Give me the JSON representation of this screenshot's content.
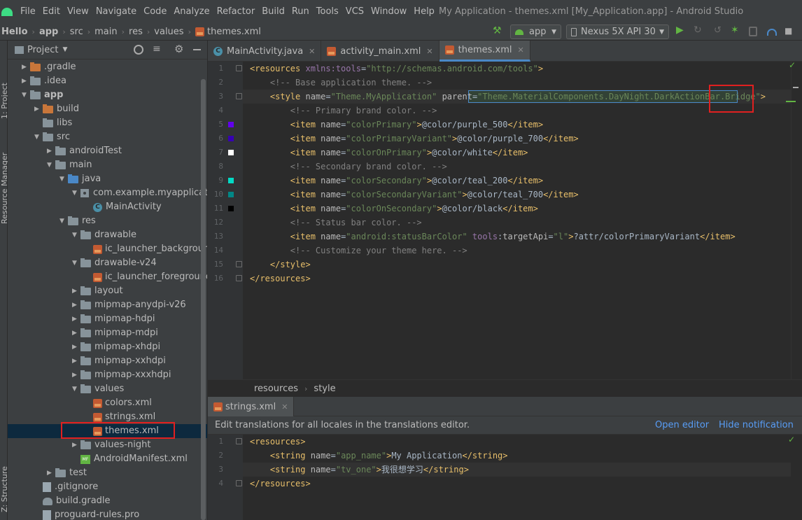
{
  "menu": {
    "items": [
      "File",
      "Edit",
      "View",
      "Navigate",
      "Code",
      "Analyze",
      "Refactor",
      "Build",
      "Run",
      "Tools",
      "VCS",
      "Window",
      "Help"
    ],
    "window_title": "My Application - themes.xml [My_Application.app] - Android Studio"
  },
  "nav": {
    "crumbs": [
      "Hello",
      "app",
      "src",
      "main",
      "res",
      "values",
      "themes.xml"
    ],
    "run_config": "app",
    "device": "Nexus 5X API 30"
  },
  "side": {
    "project_label": "1: Project",
    "resource_manager_label": "Resource Manager",
    "structure_label": "Z: Structure"
  },
  "project": {
    "view_mode": "Project",
    "tree": [
      {
        "label": ".gradle",
        "kind": "folder-orange",
        "arrow": "▶",
        "indent": 0
      },
      {
        "label": ".idea",
        "kind": "folder",
        "arrow": "▶",
        "indent": 0
      },
      {
        "label": "app",
        "kind": "folder",
        "arrow": "▼",
        "indent": 0,
        "bold": true
      },
      {
        "label": "build",
        "kind": "folder-orange",
        "arrow": "▶",
        "indent": 1
      },
      {
        "label": "libs",
        "kind": "folder",
        "arrow": "",
        "indent": 1
      },
      {
        "label": "src",
        "kind": "folder",
        "arrow": "▼",
        "indent": 1
      },
      {
        "label": "androidTest",
        "kind": "folder",
        "arrow": "▶",
        "indent": 2
      },
      {
        "label": "main",
        "kind": "folder",
        "arrow": "▼",
        "indent": 2
      },
      {
        "label": "java",
        "kind": "folder-blue",
        "arrow": "▼",
        "indent": 3
      },
      {
        "label": "com.example.myapplication",
        "kind": "package",
        "arrow": "▼",
        "indent": 4
      },
      {
        "label": "MainActivity",
        "kind": "class",
        "arrow": "",
        "indent": 5
      },
      {
        "label": "res",
        "kind": "folder",
        "arrow": "▼",
        "indent": 3
      },
      {
        "label": "drawable",
        "kind": "folder",
        "arrow": "▼",
        "indent": 4
      },
      {
        "label": "ic_launcher_background.xml",
        "kind": "xml",
        "arrow": "",
        "indent": 5
      },
      {
        "label": "drawable-v24",
        "kind": "folder",
        "arrow": "▼",
        "indent": 4
      },
      {
        "label": "ic_launcher_foreground.xml",
        "kind": "xml",
        "arrow": "",
        "indent": 5
      },
      {
        "label": "layout",
        "kind": "folder",
        "arrow": "▶",
        "indent": 4
      },
      {
        "label": "mipmap-anydpi-v26",
        "kind": "folder",
        "arrow": "▶",
        "indent": 4
      },
      {
        "label": "mipmap-hdpi",
        "kind": "folder",
        "arrow": "▶",
        "indent": 4
      },
      {
        "label": "mipmap-mdpi",
        "kind": "folder",
        "arrow": "▶",
        "indent": 4
      },
      {
        "label": "mipmap-xhdpi",
        "kind": "folder",
        "arrow": "▶",
        "indent": 4
      },
      {
        "label": "mipmap-xxhdpi",
        "kind": "folder",
        "arrow": "▶",
        "indent": 4
      },
      {
        "label": "mipmap-xxxhdpi",
        "kind": "folder",
        "arrow": "▶",
        "indent": 4
      },
      {
        "label": "values",
        "kind": "folder",
        "arrow": "▼",
        "indent": 4
      },
      {
        "label": "colors.xml",
        "kind": "xml",
        "arrow": "",
        "indent": 5
      },
      {
        "label": "strings.xml",
        "kind": "xml",
        "arrow": "",
        "indent": 5
      },
      {
        "label": "themes.xml",
        "kind": "xml",
        "arrow": "",
        "indent": 5,
        "selected": true
      },
      {
        "label": "values-night",
        "kind": "folder",
        "arrow": "▶",
        "indent": 4
      },
      {
        "label": "AndroidManifest.xml",
        "kind": "manifest",
        "arrow": "",
        "indent": 4
      },
      {
        "label": "test",
        "kind": "folder",
        "arrow": "▶",
        "indent": 2
      },
      {
        "label": ".gitignore",
        "kind": "file",
        "arrow": "",
        "indent": 1
      },
      {
        "label": "build.gradle",
        "kind": "gradle",
        "arrow": "",
        "indent": 1
      },
      {
        "label": "proguard-rules.pro",
        "kind": "file",
        "arrow": "",
        "indent": 1
      }
    ]
  },
  "editor": {
    "tabs": [
      {
        "label": "MainActivity.java",
        "icon": "java-class-icon"
      },
      {
        "label": "activity_main.xml",
        "icon": "xml-file-icon"
      },
      {
        "label": "themes.xml",
        "icon": "xml-file-icon",
        "active": true
      }
    ],
    "lines": [
      {
        "n": "1",
        "parts": [
          [
            "tg",
            "<resources "
          ],
          [
            "ns",
            "xmlns:tools"
          ],
          [
            "tx",
            "="
          ],
          [
            "av",
            "\"http://schemas.android.com/tools\""
          ],
          [
            "tg",
            ">"
          ]
        ]
      },
      {
        "n": "2",
        "parts": [
          [
            "tx",
            "    "
          ],
          [
            "cm",
            "<!-- Base application theme. -->"
          ]
        ]
      },
      {
        "n": "3",
        "parts": [
          [
            "tx",
            "    "
          ],
          [
            "tg",
            "<style "
          ],
          [
            "at",
            "name"
          ],
          [
            "tx",
            "="
          ],
          [
            "av",
            "\"Theme.MyApplication\""
          ],
          [
            "tx",
            " "
          ],
          [
            "at",
            "parent"
          ],
          [
            "tx",
            "="
          ],
          [
            "av",
            "\"Theme.MaterialComponents.DayNight.DarkActionBar.Bridge\""
          ],
          [
            "tg",
            ">"
          ]
        ]
      },
      {
        "n": "4",
        "parts": [
          [
            "tx",
            "        "
          ],
          [
            "cm",
            "<!-- Primary brand color. -->"
          ]
        ]
      },
      {
        "n": "5",
        "swatch": "#6200ee",
        "parts": [
          [
            "tx",
            "        "
          ],
          [
            "tg",
            "<item "
          ],
          [
            "at",
            "name"
          ],
          [
            "tx",
            "="
          ],
          [
            "av",
            "\"colorPrimary\""
          ],
          [
            "tg",
            ">"
          ],
          [
            "tx",
            "@color/purple_500"
          ],
          [
            "tg",
            "</item>"
          ]
        ]
      },
      {
        "n": "6",
        "swatch": "#3700b3",
        "parts": [
          [
            "tx",
            "        "
          ],
          [
            "tg",
            "<item "
          ],
          [
            "at",
            "name"
          ],
          [
            "tx",
            "="
          ],
          [
            "av",
            "\"colorPrimaryVariant\""
          ],
          [
            "tg",
            ">"
          ],
          [
            "tx",
            "@color/purple_700"
          ],
          [
            "tg",
            "</item>"
          ]
        ]
      },
      {
        "n": "7",
        "swatch": "#ffffff",
        "parts": [
          [
            "tx",
            "        "
          ],
          [
            "tg",
            "<item "
          ],
          [
            "at",
            "name"
          ],
          [
            "tx",
            "="
          ],
          [
            "av",
            "\"colorOnPrimary\""
          ],
          [
            "tg",
            ">"
          ],
          [
            "tx",
            "@color/white"
          ],
          [
            "tg",
            "</item>"
          ]
        ]
      },
      {
        "n": "8",
        "parts": [
          [
            "tx",
            "        "
          ],
          [
            "cm",
            "<!-- Secondary brand color. -->"
          ]
        ]
      },
      {
        "n": "9",
        "swatch": "#03dac5",
        "parts": [
          [
            "tx",
            "        "
          ],
          [
            "tg",
            "<item "
          ],
          [
            "at",
            "name"
          ],
          [
            "tx",
            "="
          ],
          [
            "av",
            "\"colorSecondary\""
          ],
          [
            "tg",
            ">"
          ],
          [
            "tx",
            "@color/teal_200"
          ],
          [
            "tg",
            "</item>"
          ]
        ]
      },
      {
        "n": "10",
        "swatch": "#018786",
        "parts": [
          [
            "tx",
            "        "
          ],
          [
            "tg",
            "<item "
          ],
          [
            "at",
            "name"
          ],
          [
            "tx",
            "="
          ],
          [
            "av",
            "\"colorSecondaryVariant\""
          ],
          [
            "tg",
            ">"
          ],
          [
            "tx",
            "@color/teal_700"
          ],
          [
            "tg",
            "</item>"
          ]
        ]
      },
      {
        "n": "11",
        "swatch": "#000000",
        "parts": [
          [
            "tx",
            "        "
          ],
          [
            "tg",
            "<item "
          ],
          [
            "at",
            "name"
          ],
          [
            "tx",
            "="
          ],
          [
            "av",
            "\"colorOnSecondary\""
          ],
          [
            "tg",
            ">"
          ],
          [
            "tx",
            "@color/black"
          ],
          [
            "tg",
            "</item>"
          ]
        ]
      },
      {
        "n": "12",
        "parts": [
          [
            "tx",
            "        "
          ],
          [
            "cm",
            "<!-- Status bar color. -->"
          ]
        ]
      },
      {
        "n": "13",
        "parts": [
          [
            "tx",
            "        "
          ],
          [
            "tg",
            "<item "
          ],
          [
            "at",
            "name"
          ],
          [
            "tx",
            "="
          ],
          [
            "av",
            "\"android:statusBarColor\""
          ],
          [
            "tx",
            " "
          ],
          [
            "ns",
            "tools"
          ],
          [
            "tx",
            ":"
          ],
          [
            "at",
            "targetApi"
          ],
          [
            "tx",
            "="
          ],
          [
            "av",
            "\"l\""
          ],
          [
            "tg",
            ">"
          ],
          [
            "tx",
            "?attr/colorPrimaryVariant"
          ],
          [
            "tg",
            "</item>"
          ]
        ]
      },
      {
        "n": "14",
        "parts": [
          [
            "tx",
            "        "
          ],
          [
            "cm",
            "<!-- Customize your theme here. -->"
          ]
        ]
      },
      {
        "n": "15",
        "parts": [
          [
            "tx",
            "    "
          ],
          [
            "tg",
            "</style>"
          ]
        ]
      },
      {
        "n": "16",
        "parts": [
          [
            "tg",
            "</resources>"
          ]
        ]
      }
    ],
    "breadcrumb": [
      "resources",
      "style"
    ]
  },
  "editor2": {
    "tab": "strings.xml",
    "notification": "Edit translations for all locales in the translations editor.",
    "open_editor": "Open editor",
    "hide_notification": "Hide notification",
    "lines": [
      {
        "n": "1",
        "parts": [
          [
            "tg",
            "<resources>"
          ]
        ]
      },
      {
        "n": "2",
        "parts": [
          [
            "tx",
            "    "
          ],
          [
            "tg",
            "<string "
          ],
          [
            "at",
            "name"
          ],
          [
            "tx",
            "="
          ],
          [
            "av",
            "\"app_name\""
          ],
          [
            "tg",
            ">"
          ],
          [
            "tx",
            "My Application"
          ],
          [
            "tg",
            "</string>"
          ]
        ]
      },
      {
        "n": "3",
        "parts": [
          [
            "tx",
            "    "
          ],
          [
            "tg",
            "<string "
          ],
          [
            "at",
            "name"
          ],
          [
            "tx",
            "="
          ],
          [
            "av",
            "\"tv_one\""
          ],
          [
            "tg",
            ">"
          ],
          [
            "tx",
            "我很想学习"
          ],
          [
            "tg",
            "</string>"
          ]
        ]
      },
      {
        "n": "4",
        "parts": [
          [
            "tg",
            "</resources>"
          ]
        ]
      }
    ]
  },
  "colors": {
    "accent_blue": "#4a88c7",
    "highlight_red": "#e02020",
    "selection": "#0d293e"
  }
}
